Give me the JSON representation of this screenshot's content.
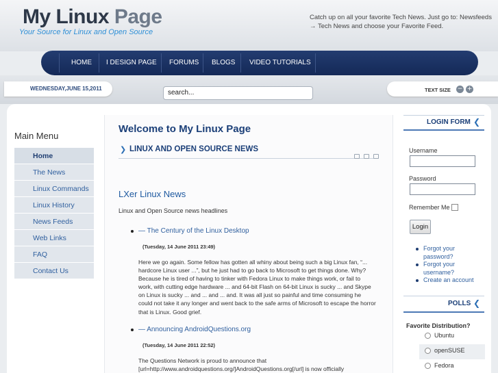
{
  "header": {
    "title_part1": "My Linux",
    "title_part2": "Page",
    "tagline": "Your Source for Linux and Open Source",
    "catchup": "Catch up on all your favorite Tech News. Just go to: Newsfeeds → Tech News and choose your Favorite Feed."
  },
  "nav": {
    "items": [
      "HOME",
      "I DESIGN PAGE",
      "FORUMS",
      "BLOGS",
      "VIDEO TUTORIALS"
    ]
  },
  "toolbar": {
    "date": "WEDNESDAY,JUNE 15,2011",
    "search_value": "search...",
    "text_size_label": "TEXT SIZE",
    "decrease_symbol": "−",
    "increase_symbol": "+"
  },
  "main_menu": {
    "title": "Main Menu",
    "items": [
      "Home",
      "The News",
      "Linux Commands",
      "Linux History",
      "News Feeds",
      "Web Links",
      "FAQ",
      "Contact Us"
    ]
  },
  "content": {
    "page_title": "Welcome to My Linux Page",
    "section_title": "LINUX AND OPEN SOURCE NEWS",
    "feed_title": "LXer Linux News",
    "feed_subtitle": "Linux and Open Source news headlines",
    "items": [
      {
        "link": "— The Century of the Linux Desktop",
        "date": "(Tuesday, 14 June 2011 23:49)",
        "lines": [
          "Here we go again. Some fellow has gotten all whiny about being such a big Linux fan, “...",
          "hardcore Linux user ...”, but he just had to go back to Microsoft to get things done. Why?",
          "Because he is tired of having to tinker with Fedora Linux to make things work, or fail to",
          "work, with cutting edge hardware ... and 64-bit Flash on 64-bit Linux is sucky ... and Skype",
          "on Linux is sucky ... and ... and ... and. It was all just so painful and time consuming he",
          "could not take it any longer and went back to the safe arms of Microsoft to escape the horror",
          "that is Linux. Good grief."
        ]
      },
      {
        "link": "— Announcing AndroidQuestions.org",
        "date": "(Tuesday, 14 June 2011 22:52)",
        "lines": [
          "The Questions Network is proud to announce that",
          "[url=http://www.androidquestions.org/]AndroidQuestions.org[/url] is now officially"
        ]
      }
    ]
  },
  "login": {
    "title": "LOGIN FORM",
    "username_label": "Username",
    "password_label": "Password",
    "remember_label": "Remember Me",
    "button_label": "Login",
    "links": [
      "Forgot your password?",
      "Forgot your username?",
      "Create an account"
    ]
  },
  "polls": {
    "title": "POLLS",
    "question": "Favorite Distribution?",
    "options": [
      "Ubuntu",
      "openSUSE",
      "Fedora"
    ]
  },
  "colors": {
    "nav_bg": "#1b3264",
    "accent_blue": "#1b3f78",
    "link_blue": "#2f5f9e",
    "tagline_blue": "#2f8fd6"
  }
}
